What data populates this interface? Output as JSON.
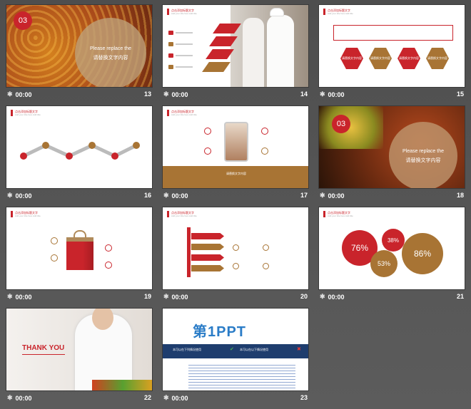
{
  "colors": {
    "accent_red": "#c9242b",
    "accent_brown": "#a87434",
    "bg": "#555555"
  },
  "slides": [
    {
      "num": "13",
      "time": "00:00",
      "badge": "03",
      "line1": "Please replace the",
      "line2": "请替换文字内容"
    },
    {
      "num": "14",
      "time": "00:00"
    },
    {
      "num": "15",
      "time": "00:00",
      "hex_labels": [
        "请替换文字内容",
        "请替换文字内容",
        "请替换文字内容",
        "请替换文字内容"
      ]
    },
    {
      "num": "16",
      "time": "00:00"
    },
    {
      "num": "17",
      "time": "00:00",
      "footer": "请替换文字内容"
    },
    {
      "num": "18",
      "time": "00:00",
      "badge": "03",
      "line1": "Please replace the",
      "line2": "请替换文字内容"
    },
    {
      "num": "19",
      "time": "00:00"
    },
    {
      "num": "20",
      "time": "00:00"
    },
    {
      "num": "21",
      "time": "00:00",
      "pct": [
        "76%",
        "38%",
        "53%",
        "86%"
      ]
    },
    {
      "num": "22",
      "time": "00:00",
      "thank": "THANK YOU"
    },
    {
      "num": "23",
      "time": "00:00",
      "logo_main": "第1PPT",
      "banner_left": "本可以在下列情况使用",
      "banner_right": "本可以在以下情况使用"
    }
  ],
  "header_text": "点击添加标题文字",
  "header_sub": "Add your title here Add title"
}
